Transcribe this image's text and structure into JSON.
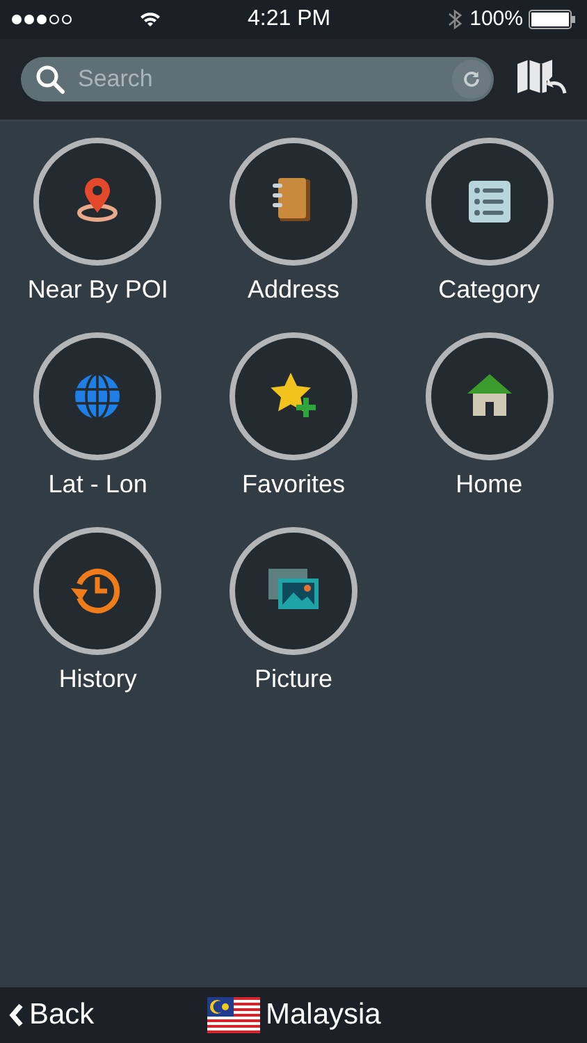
{
  "status_bar": {
    "time": "4:21 PM",
    "battery": "100%"
  },
  "search": {
    "placeholder": "Search"
  },
  "menu": [
    {
      "label": "Near By POI",
      "kind": "poi"
    },
    {
      "label": "Address",
      "kind": "address"
    },
    {
      "label": "Category",
      "kind": "category"
    },
    {
      "label": "Lat - Lon",
      "kind": "latlon"
    },
    {
      "label": "Favorites",
      "kind": "favorites"
    },
    {
      "label": "Home",
      "kind": "home"
    },
    {
      "label": "History",
      "kind": "history"
    },
    {
      "label": "Picture",
      "kind": "picture"
    }
  ],
  "footer": {
    "back": "Back",
    "country": "Malaysia"
  }
}
